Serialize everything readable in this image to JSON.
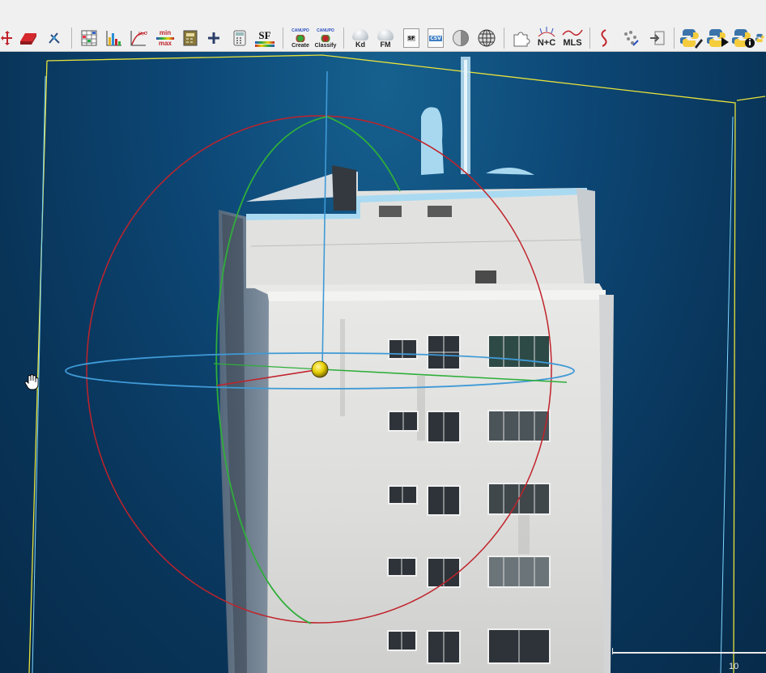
{
  "toolbar": {
    "buttons": [
      {
        "name": "translate-rotate-icon"
      },
      {
        "name": "segment-plane-icon"
      },
      {
        "name": "pick-point-icon"
      },
      {
        "name": "sf-table-icon"
      },
      {
        "name": "histogram-icon"
      },
      {
        "name": "local-statistics-icon"
      },
      {
        "name": "filter-min-max-icon",
        "top": "min",
        "bottom": "max"
      },
      {
        "name": "sf-calculator-icon"
      },
      {
        "name": "add-constant-sf-icon"
      },
      {
        "name": "calculator-icon"
      },
      {
        "name": "sf-gradient-icon",
        "label": "SF"
      },
      {
        "name": "canupo-create-icon",
        "top": "CANUPO",
        "label": "Create"
      },
      {
        "name": "canupo-classify-icon",
        "top": "CANUPO",
        "label": "Classify"
      },
      {
        "name": "kd-tree-icon",
        "label": "Kd"
      },
      {
        "name": "fast-marching-icon",
        "label": "FM"
      },
      {
        "name": "export-sf-icon",
        "label": "SF"
      },
      {
        "name": "export-csv-icon",
        "label": "CSV"
      },
      {
        "name": "sphere-icon"
      },
      {
        "name": "globe-icon"
      },
      {
        "name": "puzzle-plugin-icon"
      },
      {
        "name": "normals-curvature-icon",
        "label": "N+C"
      },
      {
        "name": "mls-smoothing-icon",
        "label": "MLS"
      },
      {
        "name": "contour-icon"
      },
      {
        "name": "scatter-points-icon"
      },
      {
        "name": "import-icon"
      },
      {
        "name": "python-edit-icon"
      },
      {
        "name": "python-run-icon"
      },
      {
        "name": "python-info-icon"
      },
      {
        "name": "python-plugin-icon"
      }
    ]
  },
  "viewport": {
    "scale_value": "10",
    "colors": {
      "background_top": "#16618f",
      "background_bottom": "#072b4a",
      "bbox": "#e8e23a",
      "gizmo_x": "#c0232b",
      "gizmo_y": "#2fae3a",
      "gizmo_z": "#3f9ad6",
      "pivot": "#e8d000",
      "facade": "#e4e4e2",
      "roof_highlight": "#9fd4ec"
    }
  }
}
